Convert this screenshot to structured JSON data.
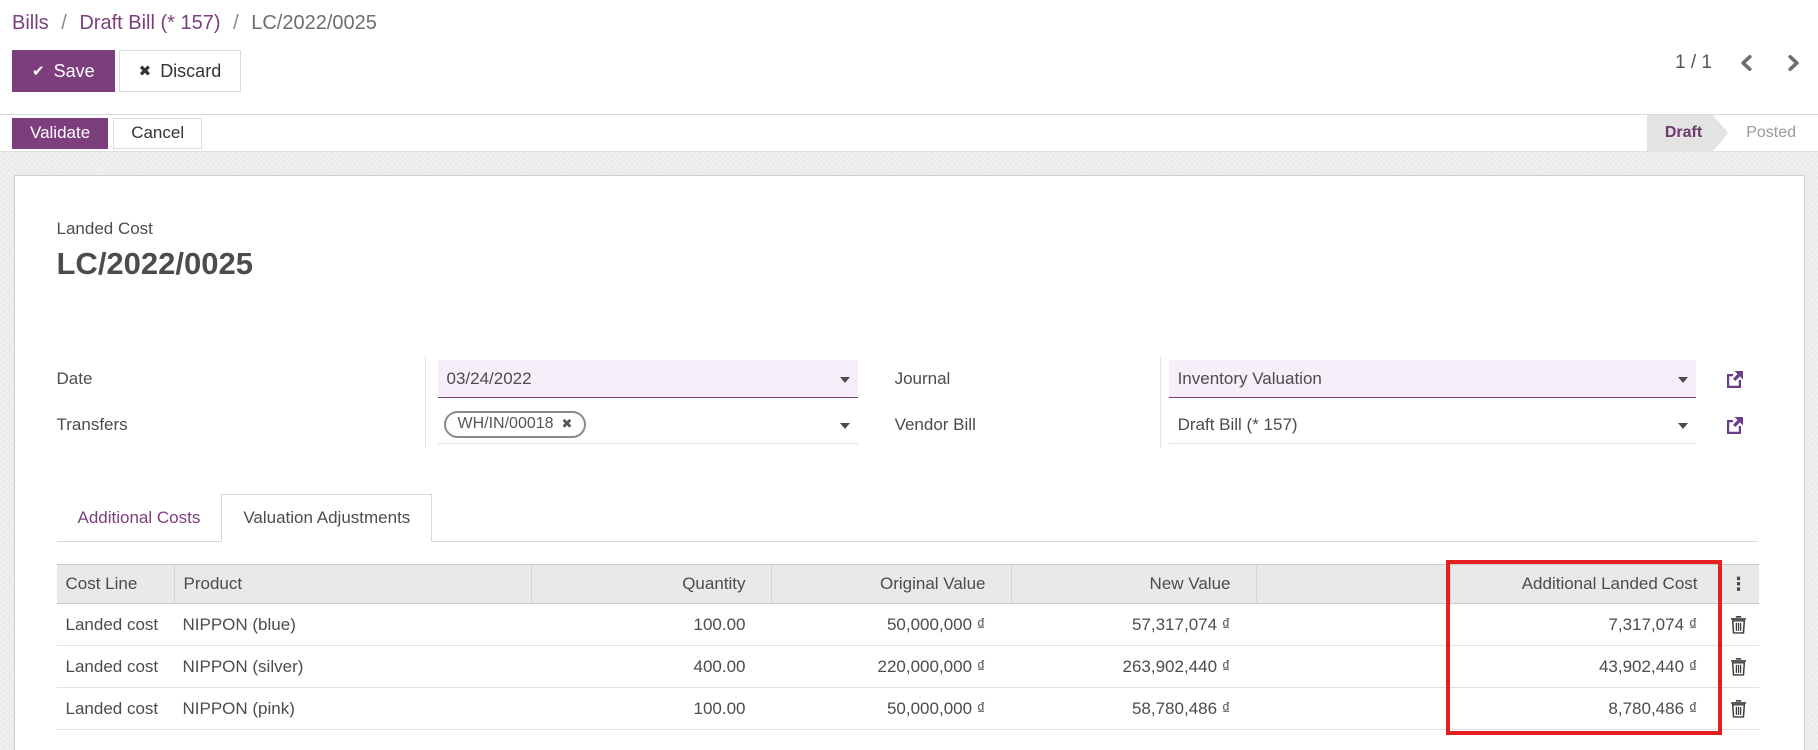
{
  "breadcrumb": {
    "separator": "/",
    "items": [
      {
        "label": "Bills"
      },
      {
        "label": "Draft Bill (* 157)"
      },
      {
        "label": "LC/2022/0025"
      }
    ]
  },
  "actions": {
    "save": "Save",
    "discard": "Discard",
    "validate": "Validate",
    "cancel": "Cancel"
  },
  "icons": {
    "save_check": "✔",
    "discard_x": "✖",
    "tag_remove": "✖",
    "kebab": "⋮"
  },
  "pager": {
    "count": "1 / 1"
  },
  "statusbar": {
    "stages": [
      {
        "label": "Draft",
        "active": true
      },
      {
        "label": "Posted",
        "active": false
      }
    ]
  },
  "form": {
    "type_label": "Landed Cost",
    "title": "LC/2022/0025",
    "fields": {
      "date": {
        "label": "Date",
        "value": "03/24/2022"
      },
      "transfers": {
        "label": "Transfers",
        "tag": "WH/IN/00018"
      },
      "journal": {
        "label": "Journal",
        "value": "Inventory Valuation"
      },
      "vendor_bill": {
        "label": "Vendor Bill",
        "value": "Draft Bill (* 157)"
      }
    }
  },
  "tabs": [
    {
      "label": "Additional Costs",
      "active": false
    },
    {
      "label": "Valuation Adjustments",
      "active": true
    }
  ],
  "table": {
    "headers": {
      "cost_line": "Cost Line",
      "product": "Product",
      "quantity": "Quantity",
      "original_value": "Original Value",
      "new_value": "New Value",
      "additional_landed_cost": "Additional Landed Cost"
    },
    "rows": [
      {
        "cost_line": "Landed cost",
        "product": "NIPPON (blue)",
        "quantity": "100.00",
        "original_value": "50,000,000 ₫",
        "new_value": "57,317,074 ₫",
        "additional_landed_cost": "7,317,074 ₫"
      },
      {
        "cost_line": "Landed cost",
        "product": "NIPPON (silver)",
        "quantity": "400.00",
        "original_value": "220,000,000 ₫",
        "new_value": "263,902,440 ₫",
        "additional_landed_cost": "43,902,440 ₫"
      },
      {
        "cost_line": "Landed cost",
        "product": "NIPPON (pink)",
        "quantity": "100.00",
        "original_value": "50,000,000 ₫",
        "new_value": "58,780,486 ₫",
        "additional_landed_cost": "8,780,486 ₫"
      }
    ],
    "highlight_color": "#e52020"
  },
  "colors": {
    "primary": "#7d3e7e",
    "field_focus_bg": "#f6eef8",
    "header_bg": "#e9e9e9",
    "highlight_red": "#e52020"
  }
}
